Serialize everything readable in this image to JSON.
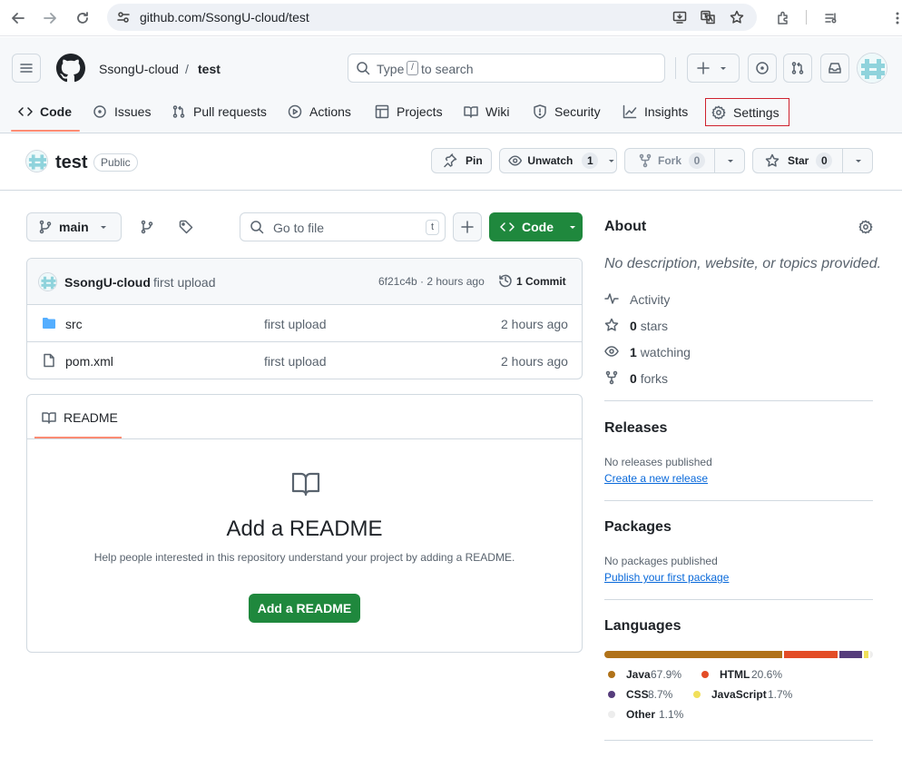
{
  "browser": {
    "url": "github.com/SsongU-cloud/test"
  },
  "header": {
    "owner": "SsongU-cloud",
    "separator": "/",
    "repo": "test",
    "search_prefix": "Type",
    "search_key": "/",
    "search_suffix": "to search"
  },
  "tabs": [
    {
      "label": "Code"
    },
    {
      "label": "Issues"
    },
    {
      "label": "Pull requests"
    },
    {
      "label": "Actions"
    },
    {
      "label": "Projects"
    },
    {
      "label": "Wiki"
    },
    {
      "label": "Security"
    },
    {
      "label": "Insights"
    },
    {
      "label": "Settings"
    }
  ],
  "repo": {
    "name": "test",
    "visibility": "Public",
    "pin_label": "Pin",
    "unwatch_label": "Unwatch",
    "watch_count": "1",
    "fork_label": "Fork",
    "fork_count": "0",
    "star_label": "Star",
    "star_count": "0"
  },
  "toolbar": {
    "branch": "main",
    "goto_placeholder": "Go to file",
    "goto_key": "t",
    "code_label": "Code"
  },
  "commit": {
    "author": "SsongU-cloud",
    "message": "first upload",
    "meta": "6f21c4b · 2 hours ago",
    "count_label": "1 Commit"
  },
  "files": [
    {
      "name": "src",
      "type": "folder",
      "message": "first upload",
      "age": "2 hours ago"
    },
    {
      "name": "pom.xml",
      "type": "file",
      "message": "first upload",
      "age": "2 hours ago"
    }
  ],
  "readme": {
    "tab_label": "README",
    "title": "Add a README",
    "description": "Help people interested in this repository understand your project by adding a README.",
    "button_label": "Add a README"
  },
  "about": {
    "title": "About",
    "description": "No description, website, or topics provided.",
    "activity_label": "Activity",
    "stars_count": "0",
    "stars_label": "stars",
    "watching_count": "1",
    "watching_label": "watching",
    "forks_count": "0",
    "forks_label": "forks"
  },
  "releases": {
    "title": "Releases",
    "empty_text": "No releases published",
    "link_text": "Create a new release"
  },
  "packages": {
    "title": "Packages",
    "empty_text": "No packages published",
    "link_text": "Publish your first package"
  },
  "languages": {
    "title": "Languages",
    "items": [
      {
        "name": "Java",
        "percent": "67.9%",
        "value": 67.9,
        "color": "#b07219"
      },
      {
        "name": "HTML",
        "percent": "20.6%",
        "value": 20.6,
        "color": "#e34c26"
      },
      {
        "name": "CSS",
        "percent": "8.7%",
        "value": 8.7,
        "color": "#563d7c"
      },
      {
        "name": "JavaScript",
        "percent": "1.7%",
        "value": 1.7,
        "color": "#f1e05a"
      },
      {
        "name": "Other",
        "percent": "1.1%",
        "value": 1.1,
        "color": "#ededed"
      }
    ]
  },
  "colors": {
    "primary_green": "#1f883d",
    "link_blue": "#0969da",
    "highlight_red": "#cf222e",
    "tab_underline": "#fd8c73"
  }
}
